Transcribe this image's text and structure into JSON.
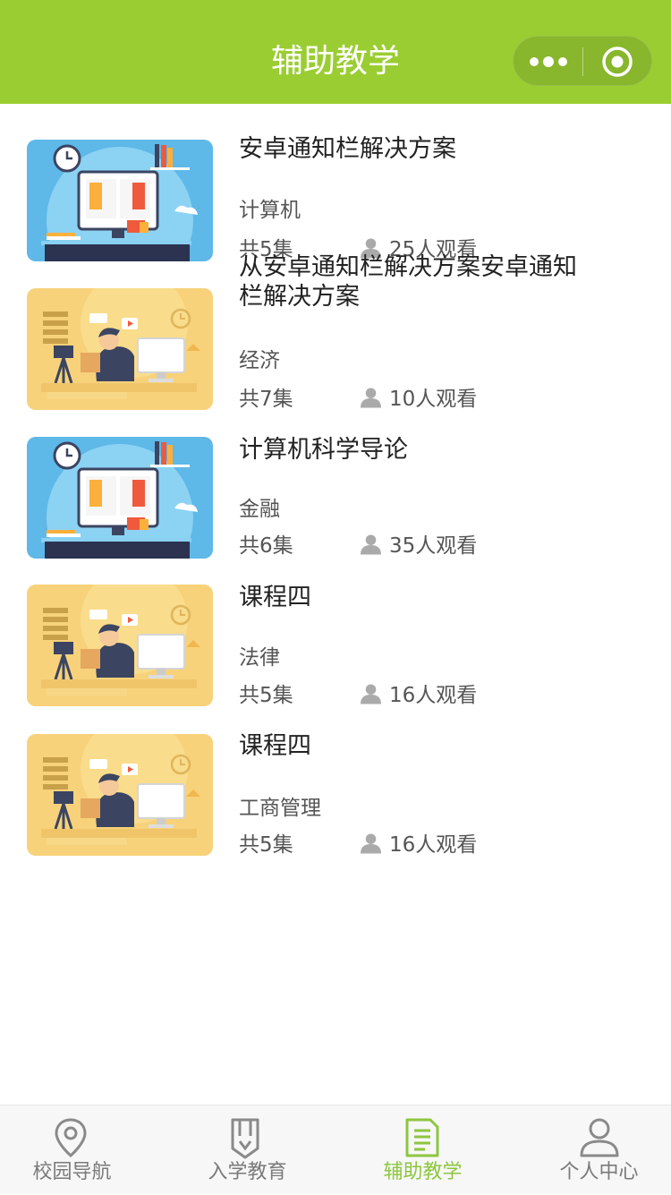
{
  "header": {
    "title": "辅助教学",
    "more_icon": "more-dots-icon",
    "close_icon": "target-close-icon",
    "background": "#9acd32"
  },
  "courses": [
    {
      "title": "安卓通知栏解决方案",
      "category": "计算机",
      "episodes": "共5集",
      "viewers": "25人观看",
      "thumbnail": "book-screen-illustration"
    },
    {
      "title": "从安卓通知栏解决方案安卓通知栏解决方案",
      "category": "经济",
      "episodes": "共7集",
      "viewers": "10人观看",
      "thumbnail": "video-recording-illustration"
    },
    {
      "title": "计算机科学导论",
      "category": "金融",
      "episodes": "共6集",
      "viewers": "35人观看",
      "thumbnail": "book-screen-illustration"
    },
    {
      "title": "课程四",
      "category": "法律",
      "episodes": "共5集",
      "viewers": "16人观看",
      "thumbnail": "video-recording-illustration"
    },
    {
      "title": "课程四",
      "category": "工商管理",
      "episodes": "共5集",
      "viewers": "16人观看",
      "thumbnail": "video-recording-illustration"
    }
  ],
  "tabbar": {
    "active_color": "#8dc63f",
    "inactive_color": "#7a7a7a",
    "items": [
      {
        "label": "校园导航",
        "icon": "location-pin-icon",
        "active": false
      },
      {
        "label": "入学教育",
        "icon": "bookmark-badge-icon",
        "active": false
      },
      {
        "label": "辅助教学",
        "icon": "document-icon",
        "active": true
      },
      {
        "label": "个人中心",
        "icon": "person-icon",
        "active": false
      }
    ]
  }
}
